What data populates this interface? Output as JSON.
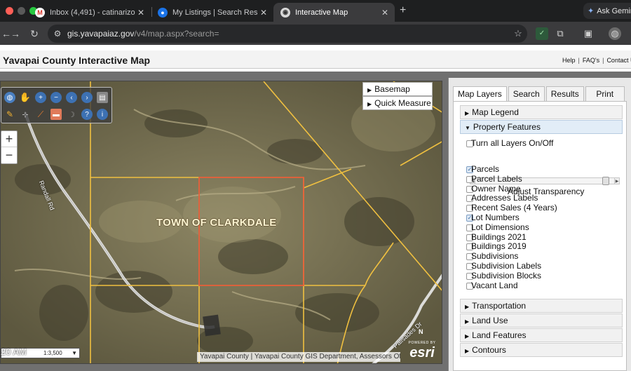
{
  "browser": {
    "tabs": [
      {
        "title": "Inbox (4,491) - catinarizona@",
        "icon": "gmail-icon"
      },
      {
        "title": "My Listings | Search Results |",
        "icon": "listings-icon"
      },
      {
        "title": "Interactive Map",
        "icon": "map-site-icon",
        "active": true
      }
    ],
    "new_tab_label": "+",
    "gemini_label": "Ask Gemin",
    "url_host": "gis.yavapaiaz.gov",
    "url_path": "/v4/map.aspx?search="
  },
  "header": {
    "title": "Yavapai County Interactive Map",
    "links": [
      "Help",
      "FAQ's",
      "Contact U"
    ]
  },
  "map": {
    "basemap_label": "Basemap",
    "quick_measure_label": "Quick Measure",
    "town_label": "TOWN OF CLARKDALE",
    "road_labels": [
      "Randall Rd",
      "Palisades Dr"
    ],
    "scale_value": "1:3,500",
    "time_overlay": "20 AM",
    "attribution": "Yavapai County | Yavapai County GIS Department, Assessors Of...",
    "esri_powered": "POWERED BY",
    "esri_word": "esri",
    "north_label": "N",
    "zoom_in": "+",
    "zoom_out": "−"
  },
  "panel": {
    "tabs": [
      "Map Layers",
      "Search",
      "Results",
      "Print"
    ],
    "sections_top": [
      "Map Legend",
      "Property Features"
    ],
    "toggle_all": "Turn all Layers On/Off",
    "transparency_label": "Adjust Transparency",
    "layers": [
      {
        "label": "Parcels",
        "checked": true
      },
      {
        "label": "Parcel Labels",
        "checked": false
      },
      {
        "label": "Owner Name",
        "checked": false
      },
      {
        "label": "Addresses Labels",
        "checked": false
      },
      {
        "label": "Recent Sales (4 Years)",
        "checked": false
      },
      {
        "label": "Lot Numbers",
        "checked": true
      },
      {
        "label": "Lot Dimensions",
        "checked": false
      },
      {
        "label": "Buildings 2021",
        "checked": false
      },
      {
        "label": "Buildings 2019",
        "checked": false
      },
      {
        "label": "Subdivisions",
        "checked": false
      },
      {
        "label": "Subdivision Labels",
        "checked": false
      },
      {
        "label": "Subdivision Blocks",
        "checked": false
      },
      {
        "label": "Vacant Land",
        "checked": false
      }
    ],
    "sections_bottom": [
      "Transportation",
      "Land Use",
      "Land Features",
      "Contours"
    ]
  },
  "colors": {
    "parcel_line": "#f0c040",
    "selected_parcel": "#e8603a",
    "road": "#f2f2f2"
  }
}
